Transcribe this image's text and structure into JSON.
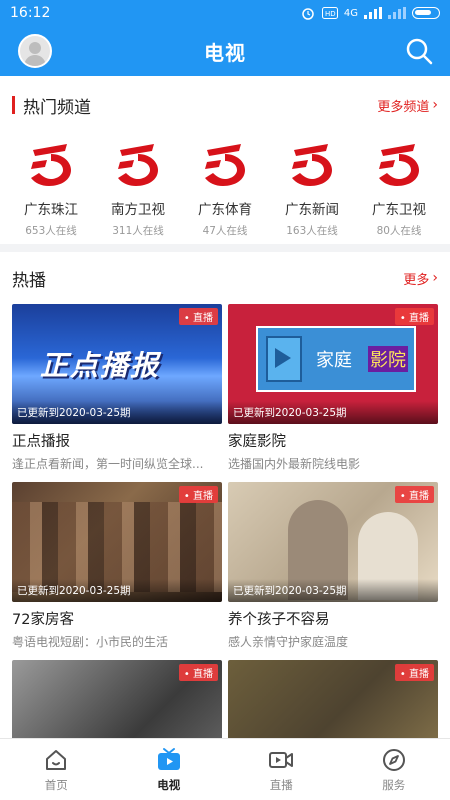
{
  "status_bar": {
    "time": "16:12",
    "network": "4G"
  },
  "header": {
    "title": "电视"
  },
  "hot_channels": {
    "title": "热门频道",
    "more_label": "更多频道",
    "items": [
      {
        "name": "广东珠江",
        "online": "653人在线"
      },
      {
        "name": "南方卫视",
        "online": "311人在线"
      },
      {
        "name": "广东体育",
        "online": "47人在线"
      },
      {
        "name": "广东新闻",
        "online": "163人在线"
      },
      {
        "name": "广东卫视",
        "online": "80人在线"
      }
    ]
  },
  "hot": {
    "title": "热播",
    "more_label": "更多",
    "live_label": "直播",
    "cards": [
      {
        "title": "正点播报",
        "desc": "逢正点看新闻，第一时间纵览全球...",
        "update": "已更新到2020-03-25期",
        "thumb_text": "正点播报"
      },
      {
        "title": "家庭影院",
        "desc": "选播国内外最新院线电影",
        "update": "已更新到2020-03-25期",
        "thumb_text_1": "家庭",
        "thumb_text_2": "影院"
      },
      {
        "title": "72家房客",
        "desc": "粤语电视短剧：小市民的生活",
        "update": "已更新到2020-03-25期"
      },
      {
        "title": "养个孩子不容易",
        "desc": "感人亲情守护家庭温度",
        "update": "已更新到2020-03-25期"
      },
      {
        "title": "",
        "desc": "",
        "update": ""
      },
      {
        "title": "",
        "desc": "",
        "update": ""
      }
    ]
  },
  "bottom_nav": [
    {
      "label": "首页",
      "icon": "home-icon"
    },
    {
      "label": "电视",
      "icon": "tv-icon"
    },
    {
      "label": "直播",
      "icon": "video-icon"
    },
    {
      "label": "服务",
      "icon": "compass-icon"
    }
  ],
  "colors": {
    "primary": "#2196f3",
    "accent_red": "#e0201f"
  }
}
